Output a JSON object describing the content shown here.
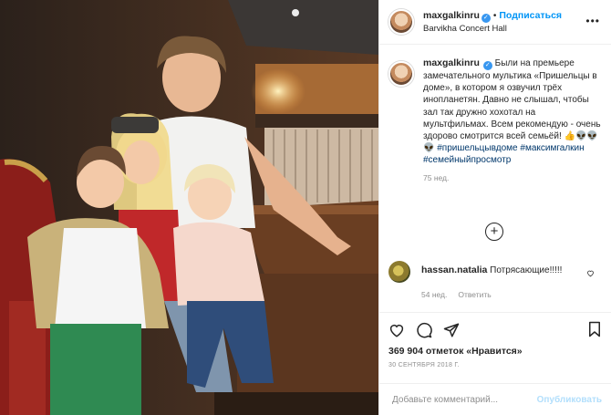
{
  "post": {
    "username": "maxgalkinru",
    "follow_label": "Подписаться",
    "location": "Barvikha Concert Hall",
    "caption": "Были на премьере замечательного мультика «Пришельцы в доме», в котором я озвучил трёх инопланетян. Давно не слышал, чтобы зал так дружно хохотал на мультфильмах. Всем рекомендую - очень здорово смотрится всей семьёй! 👍👽👽👽",
    "hashtags": [
      "#пришельцывдоме",
      "#максимгалкин",
      "#семейныйпросмотр"
    ],
    "caption_age": "75 нед.",
    "likes_count": "369 904",
    "likes_word": "отметок",
    "likes_suffix": "«Нравится»",
    "date": "30 СЕНТЯБРЯ 2018 Г.",
    "add_comment_placeholder": "Добавьте комментарий...",
    "publish_label": "Опубликовать",
    "verified_icon": "verified-check-icon",
    "more_icon": "more-options-icon"
  },
  "comments": [
    {
      "username": "hassan.natalia",
      "text": "Потрясающие!!!!!",
      "age": "54 нед.",
      "reply_label": "Ответить"
    }
  ],
  "colors": {
    "accent": "#0095f6",
    "hashtag": "#00376b",
    "muted": "#8e8e8e",
    "border": "#efefef"
  }
}
